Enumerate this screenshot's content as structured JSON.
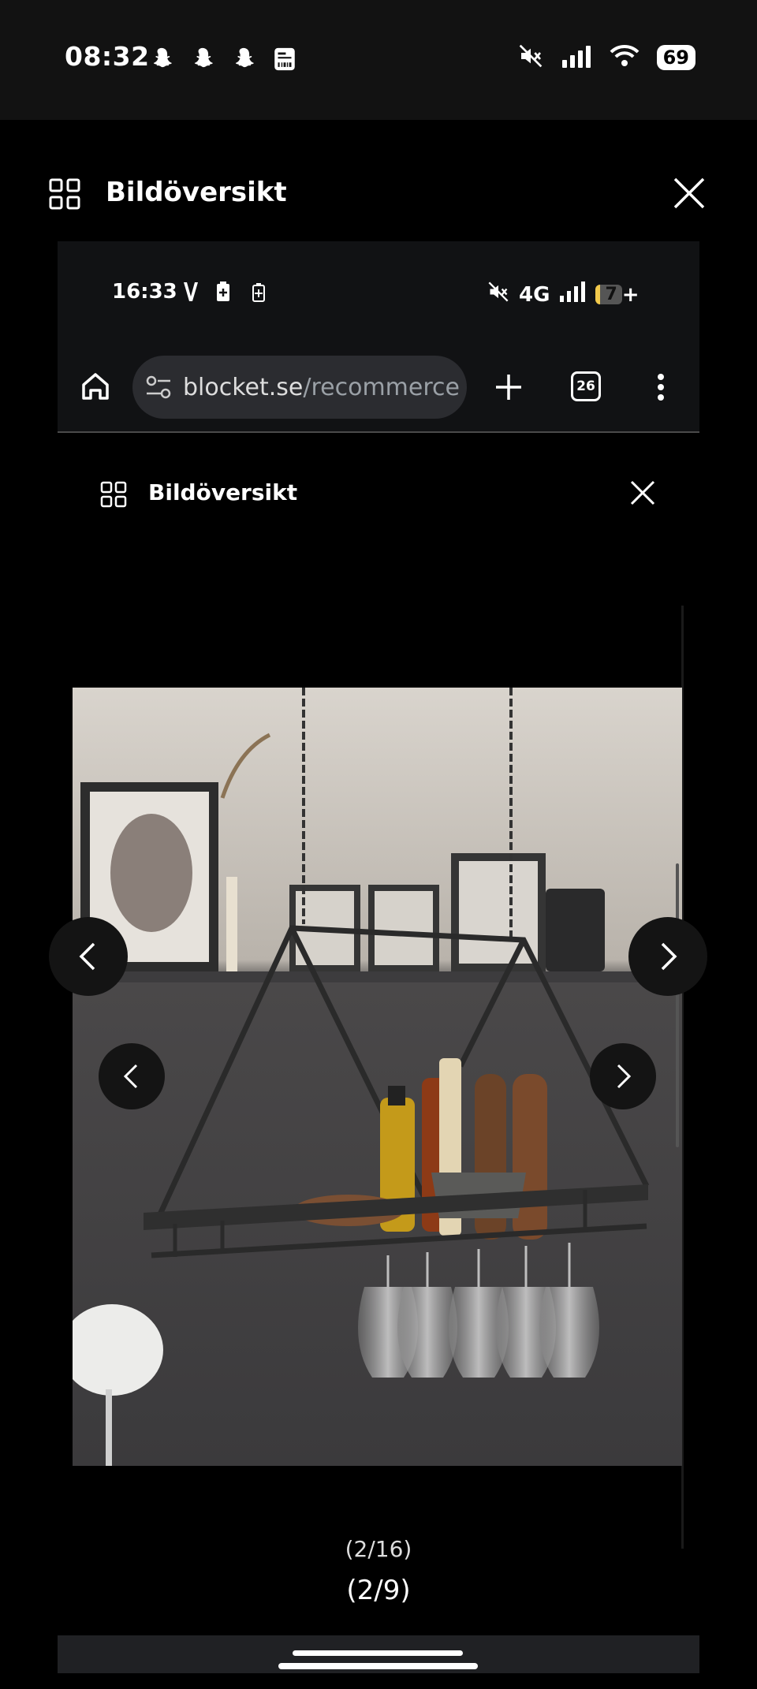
{
  "outer_status": {
    "time": "08:32",
    "notification_icons": [
      "snapchat-icon",
      "snapchat-icon",
      "snapchat-icon",
      "receipt-icon"
    ],
    "battery": "69"
  },
  "outer_header": {
    "title": "Bildöversikt"
  },
  "inner_status": {
    "time": "16:33",
    "network": "4G",
    "battery": "7"
  },
  "browser": {
    "url_domain": "blocket.se",
    "url_path": "/recommerce/",
    "tab_count": "26"
  },
  "inner_header": {
    "title": "Bildöversikt"
  },
  "viewer": {
    "counter_inner": "(2/16)",
    "counter_outer": "(2/9)"
  },
  "colors": {
    "background": "#000000",
    "status_bar": "#121212",
    "url_bar": "#2b2c30"
  }
}
